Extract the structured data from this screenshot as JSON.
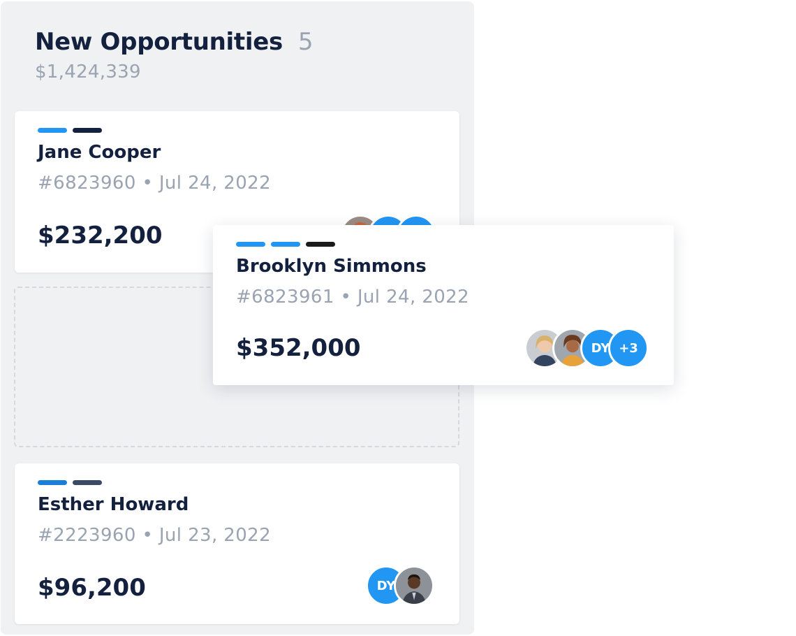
{
  "column": {
    "title": "New Opportunities",
    "count": "5",
    "total": "$1,424,339"
  },
  "cards": [
    {
      "name": "Jane Cooper",
      "meta": "#6823960 • Jul 24, 2022",
      "amount": "$232,200",
      "tag_colors": [
        "#2196f3",
        "#13213f"
      ]
    },
    {
      "name": "Brooklyn Simmons",
      "meta": "#6823961 • Jul 24, 2022",
      "amount": "$352,000",
      "tag_colors": [
        "#2196f3",
        "#2196f3",
        "#1b1b1b"
      ],
      "avatars": [
        {
          "type": "photo",
          "icon": "woman-photo-avatar"
        },
        {
          "type": "photo",
          "icon": "woman-photo-avatar"
        },
        {
          "type": "initials",
          "text": "DY"
        },
        {
          "type": "more",
          "text": "+3"
        }
      ]
    },
    {
      "name": "Esther Howard",
      "meta": "#2223960 • Jul 23, 2022",
      "amount": "$96,200",
      "tag_colors": [
        "#1a7fd6",
        "#3a4a66"
      ],
      "avatars": [
        {
          "type": "initials",
          "text": "DY"
        },
        {
          "type": "photo",
          "icon": "man-photo-avatar"
        }
      ]
    }
  ],
  "colors": {
    "accent_blue": "#2196f3",
    "navy_text": "#13213f",
    "muted_text": "#9aa3b2",
    "column_bg": "#f0f1f3"
  }
}
